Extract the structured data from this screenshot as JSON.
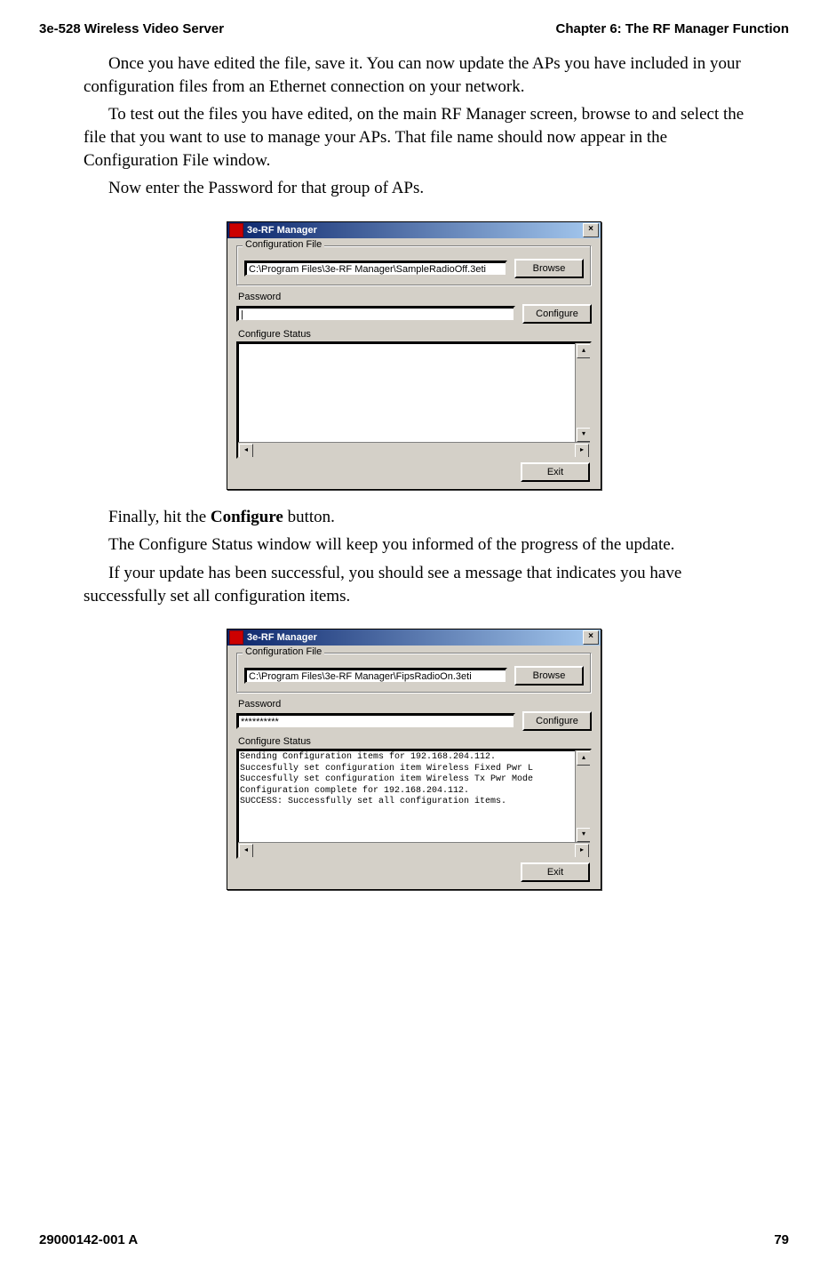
{
  "header": {
    "left": "3e-528 Wireless Video Server",
    "right": "Chapter 6: The RF Manager Function"
  },
  "paragraphs": {
    "p1": "Once you have edited the file, save it. You can now update the APs you have included in your configuration files from an Ethernet connection on your network.",
    "p2": "To test out the files you have edited, on the main RF Manager screen, browse to and select the file that you want to use to manage your APs. That file name should now appear in the Configuration File window.",
    "p3": "Now enter the  Password for that group of APs.",
    "p4a": "Finally, hit the ",
    "p4b": "Configure",
    "p4c": " button.",
    "p5": "The Configure Status window will keep you informed of the progress of the update.",
    "p6": "If your update has been successful, you should see a message that indicates you have successfully set all configuration items."
  },
  "dialog1": {
    "title": "3e-RF Manager",
    "close_glyph": "×",
    "groupbox_label": "Configuration File",
    "file_path": "C:\\Program Files\\3e-RF Manager\\SampleRadioOff.3eti",
    "browse_label": "Browse",
    "password_label": "Password",
    "password_value": "|",
    "configure_label": "Configure",
    "status_label": "Configure Status",
    "exit_label": "Exit",
    "up": "▴",
    "down": "▾",
    "left": "◂",
    "right": "▸"
  },
  "dialog2": {
    "title": "3e-RF Manager",
    "close_glyph": "×",
    "groupbox_label": "Configuration File",
    "file_path": "C:\\Program Files\\3e-RF Manager\\FipsRadioOn.3eti",
    "browse_label": "Browse",
    "password_label": "Password",
    "password_value": "**********",
    "configure_label": "Configure",
    "status_label": "Configure Status",
    "status_lines": [
      "Sending Configuration items for 192.168.204.112.",
      "Succesfully set configuration item Wireless Fixed Pwr L",
      "Succesfully set configuration item Wireless Tx Pwr Mode",
      "Configuration complete for 192.168.204.112.",
      "SUCCESS: Successfully set all configuration items."
    ],
    "exit_label": "Exit",
    "up": "▴",
    "down": "▾",
    "left": "◂",
    "right": "▸"
  },
  "footer": {
    "left": "29000142-001 A",
    "right": "79"
  }
}
